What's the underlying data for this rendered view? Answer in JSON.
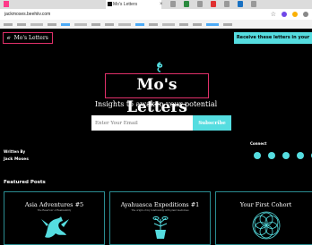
{
  "browser": {
    "tab_title": "Mo's Letters",
    "tab_close": "×",
    "url": "jackmoses.beehiiv.com"
  },
  "header": {
    "brand_mark": "ℯ",
    "brand_name": "Mo's Letters",
    "cta_label": "Receive these letters in your inbox"
  },
  "hero": {
    "title": "Mo's Letters",
    "subtitle": "Insights to awaken your potential",
    "email_placeholder": "Enter Your Email",
    "subscribe_label": "Subscribe"
  },
  "author": {
    "written_by_label": "Written By",
    "name": "Jack Moses"
  },
  "connect": {
    "label": "Connect",
    "icons": [
      "social-icon-1",
      "social-icon-2",
      "social-icon-3",
      "social-icon-4",
      "social-icon-5"
    ]
  },
  "featured": {
    "label": "Featured Posts",
    "posts": [
      {
        "title": "Asia Adventures #5",
        "subtitle": "The Reservoir of Realizability",
        "art": "dragon"
      },
      {
        "title": "Ayahuasca Expeditions #1",
        "subtitle": "The origin of my relationship with plant medicines",
        "art": "plant-pot"
      },
      {
        "title": "Your First Cohort",
        "subtitle": "",
        "art": "mandala"
      }
    ]
  },
  "colors": {
    "accent": "#55dde0",
    "highlight_box": "#e0306a",
    "background": "#000000"
  }
}
